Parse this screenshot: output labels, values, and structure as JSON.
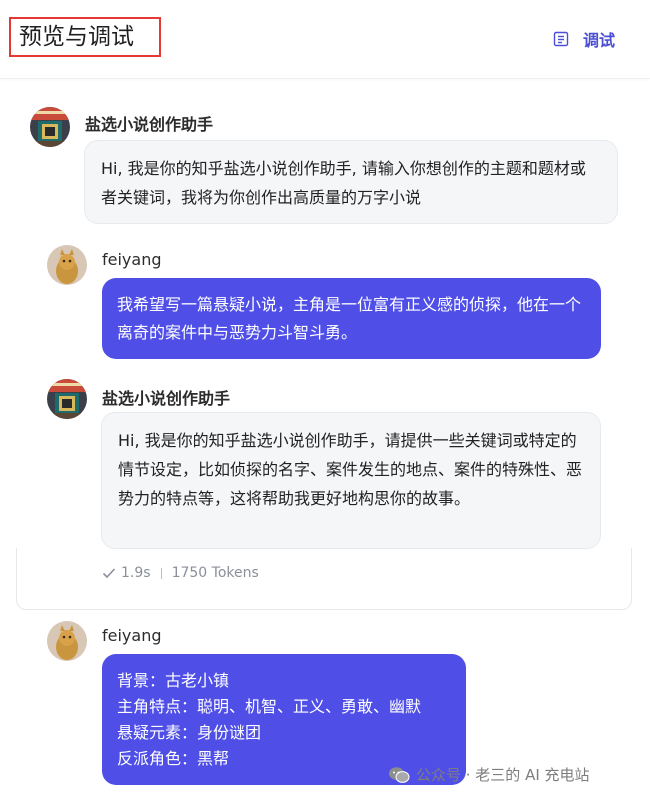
{
  "header": {
    "title": "预览与调试",
    "debug_label": "调试",
    "debug_icon": "document-list-icon"
  },
  "colors": {
    "accent": "#4f4fe8",
    "link": "#4a4fd6",
    "highlight_border": "#e53935",
    "bot_bubble_bg": "#f5f6f8"
  },
  "messages": [
    {
      "role": "bot",
      "sender": "盐选小说创作助手",
      "text": "Hi, 我是你的知乎盐选小说创作助手, 请输入你想创作的主题和题材或者关键词，我将为你创作出高质量的万字小说"
    },
    {
      "role": "user",
      "sender": "feiyang",
      "text": "我希望写一篇悬疑小说，主角是一位富有正义感的侦探，他在一个离奇的案件中与恶势力斗智斗勇。"
    },
    {
      "role": "bot",
      "sender": "盐选小说创作助手",
      "text": "Hi, 我是你的知乎盐选小说创作助手，请提供一些关键词或特定的情节设定，比如侦探的名字、案件发生的地点、案件的特殊性、恶势力的特点等，这将帮助我更好地构思你的故事。",
      "meta": {
        "time": "1.9s",
        "tokens": "1750 Tokens"
      }
    },
    {
      "role": "user",
      "sender": "feiyang",
      "lines": [
        "背景：古老小镇",
        "主角特点：聪明、机智、正义、勇敢、幽默",
        "悬疑元素：身份谜团",
        "反派角色：黑帮"
      ]
    }
  ],
  "watermark": {
    "text": "公众号 · 老三的 AI 充电站",
    "icon": "wechat-icon"
  }
}
